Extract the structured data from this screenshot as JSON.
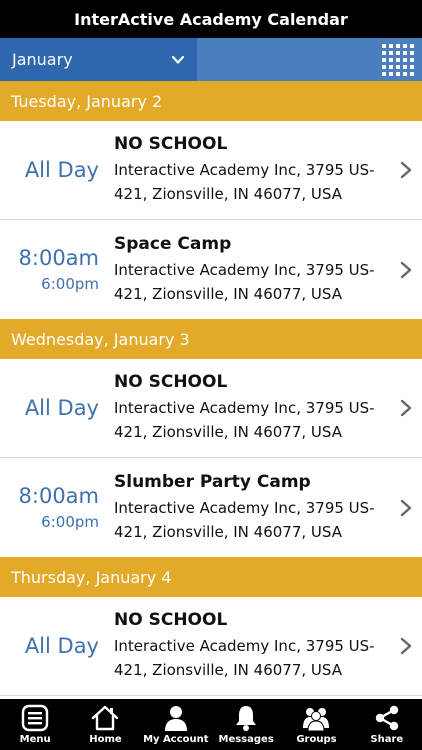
{
  "app": {
    "title": "InterActive Academy Calendar"
  },
  "month_selector": {
    "value": "January"
  },
  "days": [
    {
      "header": "Tuesday, January 2",
      "events": [
        {
          "all_day": "All Day",
          "title": "NO SCHOOL",
          "location_line1": "Interactive Academy Inc, 3795 US-",
          "location_line2": "421, Zionsville, IN 46077, USA"
        },
        {
          "start": "8:00am",
          "end": "6:00pm",
          "title": "Space Camp",
          "location_line1": "Interactive Academy Inc, 3795 US-",
          "location_line2": "421, Zionsville, IN 46077, USA"
        }
      ]
    },
    {
      "header": "Wednesday, January 3",
      "events": [
        {
          "all_day": "All Day",
          "title": "NO SCHOOL",
          "location_line1": "Interactive Academy Inc, 3795 US-",
          "location_line2": "421, Zionsville, IN 46077, USA"
        },
        {
          "start": "8:00am",
          "end": "6:00pm",
          "title": "Slumber Party Camp",
          "location_line1": "Interactive Academy Inc, 3795 US-",
          "location_line2": "421, Zionsville, IN 46077, USA"
        }
      ]
    },
    {
      "header": "Thursday, January 4",
      "events": [
        {
          "all_day": "All Day",
          "title": "NO SCHOOL",
          "location_line1": "Interactive Academy Inc, 3795 US-",
          "location_line2": "421, Zionsville, IN 46077, USA"
        }
      ]
    }
  ],
  "tabs": [
    {
      "label": "Menu",
      "icon": "menu-icon"
    },
    {
      "label": "Home",
      "icon": "home-icon"
    },
    {
      "label": "My Account",
      "icon": "account-icon"
    },
    {
      "label": "Messages",
      "icon": "bell-icon"
    },
    {
      "label": "Groups",
      "icon": "groups-icon"
    },
    {
      "label": "Share",
      "icon": "share-icon"
    }
  ],
  "colors": {
    "title_bar": "#000000",
    "month_bar": "#4a7ebf",
    "month_select": "#2f67ae",
    "day_header": "#e3a929",
    "time_text": "#3e72ad",
    "tab_bar": "#000000"
  }
}
